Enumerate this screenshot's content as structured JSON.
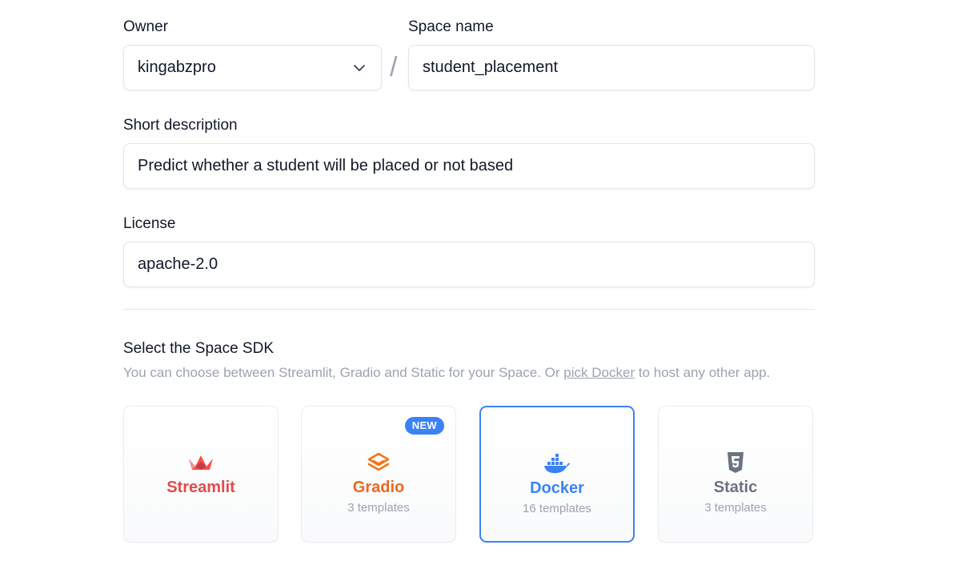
{
  "owner": {
    "label": "Owner",
    "value": "kingabzpro"
  },
  "separator": "/",
  "space_name": {
    "label": "Space name",
    "value": "student_placement"
  },
  "short_description": {
    "label": "Short description",
    "value": "Predict whether a student will be placed or not based"
  },
  "license": {
    "label": "License",
    "value": "apache-2.0"
  },
  "sdk": {
    "title": "Select the Space SDK",
    "subtitle_prefix": "You can choose between Streamlit, Gradio and Static for your Space. Or ",
    "subtitle_link": "pick Docker",
    "subtitle_suffix": " to host any other app.",
    "options": [
      {
        "name": "Streamlit",
        "templates": "",
        "icon": "streamlit-crown-icon",
        "color": "#e24a4a",
        "selected": false
      },
      {
        "name": "Gradio",
        "templates": "3 templates",
        "icon": "gradio-logo-icon",
        "color": "#f0661b",
        "badge": "NEW",
        "selected": false
      },
      {
        "name": "Docker",
        "templates": "16 templates",
        "icon": "docker-whale-icon",
        "color": "#3b82f6",
        "selected": true
      },
      {
        "name": "Static",
        "templates": "3 templates",
        "icon": "html5-shield-icon",
        "color": "#6b7280",
        "selected": false
      }
    ]
  },
  "colors": {
    "accent": "#3b82f6",
    "border": "#e2e5ea",
    "muted_text": "#9ca3af"
  }
}
